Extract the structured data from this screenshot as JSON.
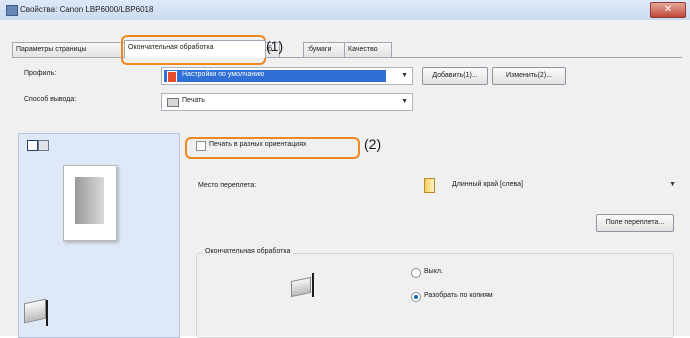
{
  "window": {
    "title": "Свойства: Canon LBP6000/LBP6018",
    "close_glyph": "✕"
  },
  "tabs": [
    {
      "label": "Параметры страницы",
      "active": false
    },
    {
      "label": "Окончательная обработка",
      "active": true
    },
    {
      "label": "б",
      "active": false
    },
    {
      "label": ":бумаги",
      "active": false
    },
    {
      "label": "Качество",
      "active": false
    }
  ],
  "callouts": {
    "one": "(1)",
    "two": "(2)",
    "color": "#f0881e"
  },
  "profile": {
    "label": "Профиль:",
    "value": "Настройки по умолчанию",
    "add_button": "Добавить(1)...",
    "edit_button": "Изменить(2)..."
  },
  "output_method": {
    "label": "Способ вывода:",
    "value": "Печать"
  },
  "orientation_checkbox": {
    "label": "Печать в разных ориентациях",
    "checked": false
  },
  "binding": {
    "label": "Место переплета:",
    "value": "Длинный край [слева]",
    "gutter_button": "Поле переплета..."
  },
  "finishing": {
    "group_label": "Окончательная обработка",
    "options": [
      {
        "label": "Выкл.",
        "selected": false
      },
      {
        "label": "Разобрать по копиям",
        "selected": true
      }
    ]
  },
  "colors": {
    "accent": "#1f5fc7",
    "selected_profile_bg": "#2f6fd6",
    "preview_bg": "#dfe8f6"
  },
  "icons": [
    "printer-icon",
    "profile-icon",
    "document-icon",
    "staple-icon",
    "page-view-icon",
    "printer-view-icon"
  ]
}
